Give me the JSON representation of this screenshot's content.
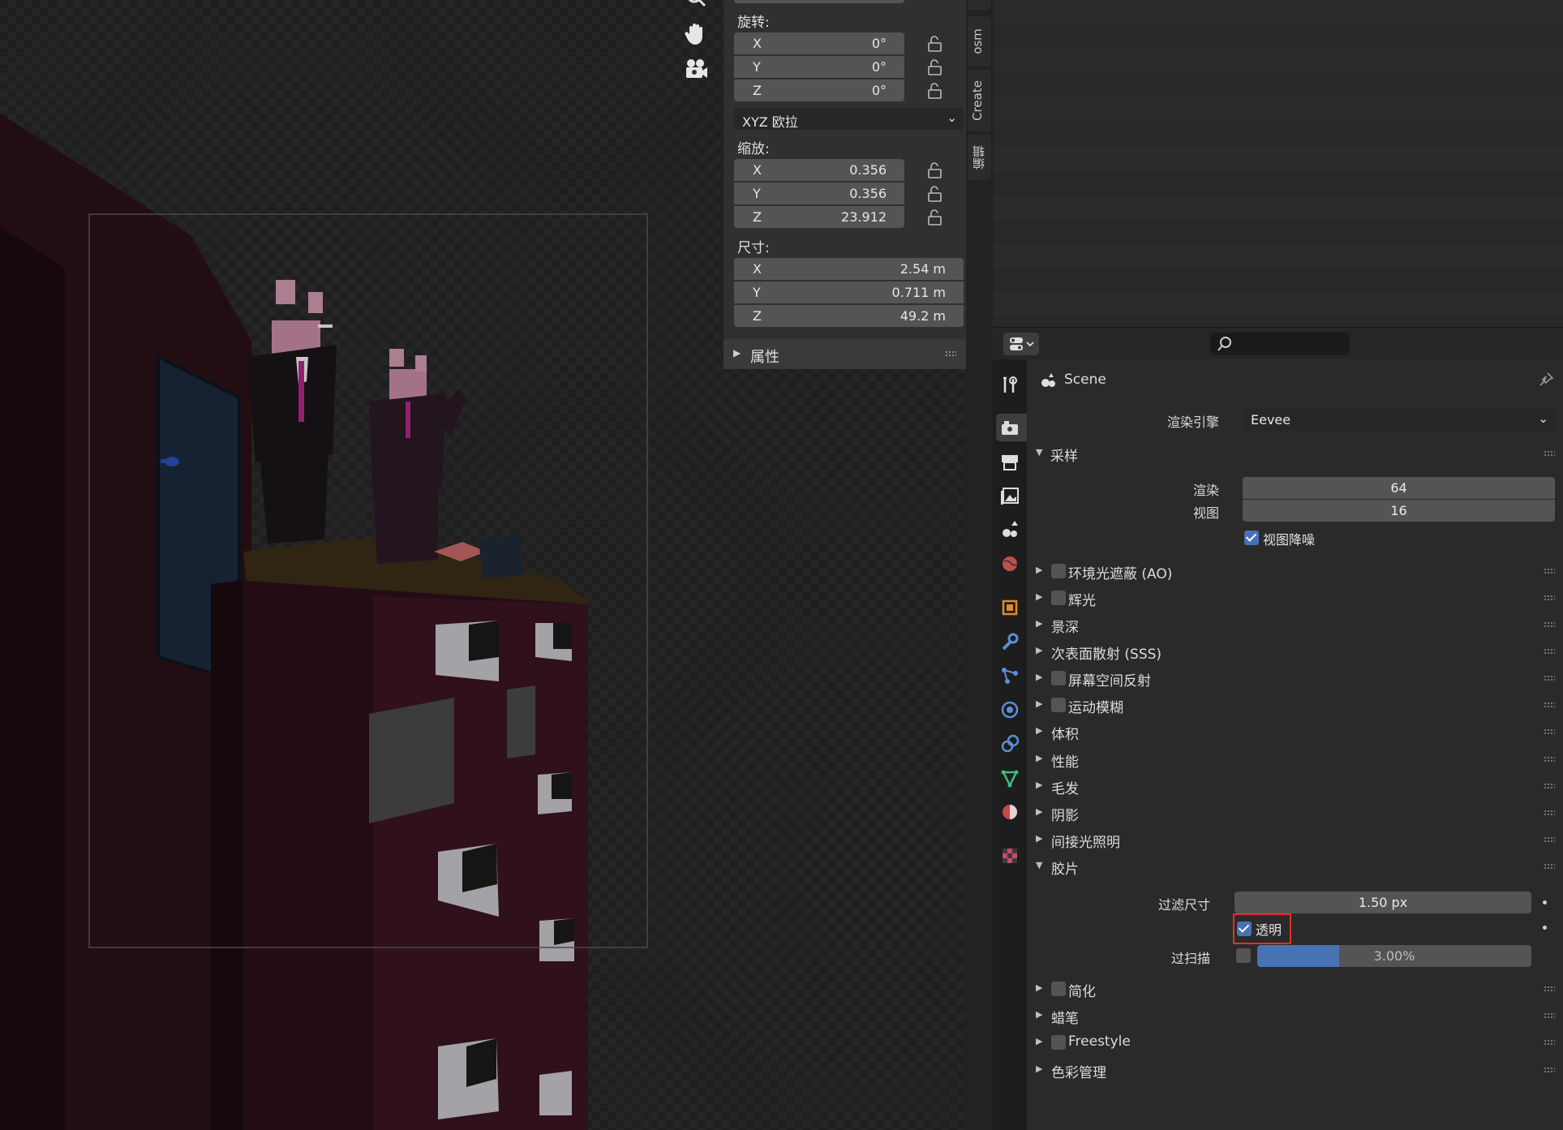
{
  "npanel": {
    "rotation_label": "旋转:",
    "rotation": [
      {
        "axis": "X",
        "value": "0°"
      },
      {
        "axis": "Y",
        "value": "0°"
      },
      {
        "axis": "Z",
        "value": "0°"
      }
    ],
    "rotation_mode": "XYZ 欧拉",
    "scale_label": "缩放:",
    "scale": [
      {
        "axis": "X",
        "value": "0.356"
      },
      {
        "axis": "Y",
        "value": "0.356"
      },
      {
        "axis": "Z",
        "value": "23.912"
      }
    ],
    "dimensions_label": "尺寸:",
    "dimensions": [
      {
        "axis": "X",
        "value": "2.54 m"
      },
      {
        "axis": "Y",
        "value": "0.711 m"
      },
      {
        "axis": "Z",
        "value": "49.2 m"
      }
    ],
    "attributes_label": "属性"
  },
  "vertical_tabs": [
    "osm",
    "Create",
    "编辑"
  ],
  "viewport_tools": [
    "hand-icon",
    "camera-icon"
  ],
  "properties": {
    "context": "Scene",
    "render_engine_label": "渲染引擎",
    "render_engine": "Eevee",
    "sampling": {
      "title": "采样",
      "render_label": "渲染",
      "render_value": "64",
      "viewport_label": "视图",
      "viewport_value": "16",
      "denoise_label": "视图降噪",
      "denoise_checked": true
    },
    "panels_a": [
      {
        "title": "环境光遮蔽 (AO)",
        "checkbox": true
      },
      {
        "title": "辉光",
        "checkbox": true
      },
      {
        "title": "景深",
        "checkbox": false
      },
      {
        "title": "次表面散射 (SSS)",
        "checkbox": false
      },
      {
        "title": "屏幕空间反射",
        "checkbox": true
      },
      {
        "title": "运动模糊",
        "checkbox": true
      },
      {
        "title": "体积",
        "checkbox": false
      },
      {
        "title": "性能",
        "checkbox": false
      },
      {
        "title": "毛发",
        "checkbox": false
      },
      {
        "title": "阴影",
        "checkbox": false
      },
      {
        "title": "间接光照明",
        "checkbox": false
      }
    ],
    "film": {
      "title": "胶片",
      "filter_size_label": "过滤尺寸",
      "filter_size_value": "1.50 px",
      "transparent_label": "透明",
      "transparent_checked": true,
      "overscan_label": "过扫描",
      "overscan_checked": false,
      "overscan_value": "3.00%",
      "overscan_fraction": 0.3
    },
    "panels_b": [
      {
        "title": "简化",
        "checkbox": true
      },
      {
        "title": "蜡笔",
        "checkbox": false
      },
      {
        "title": "Freestyle",
        "checkbox": true
      },
      {
        "title": "色彩管理",
        "checkbox": false
      }
    ],
    "tab_icons": [
      "tool-icon",
      "render-icon",
      "output-icon",
      "view-layer-icon",
      "scene-icon",
      "world-icon",
      "object-icon",
      "modifier-icon",
      "particles-icon",
      "physics-icon",
      "constraints-icon",
      "object-data-icon",
      "material-icon",
      "texture-icon"
    ]
  },
  "colors": {
    "accent": "#4772b3",
    "highlight": "#e0302b"
  }
}
